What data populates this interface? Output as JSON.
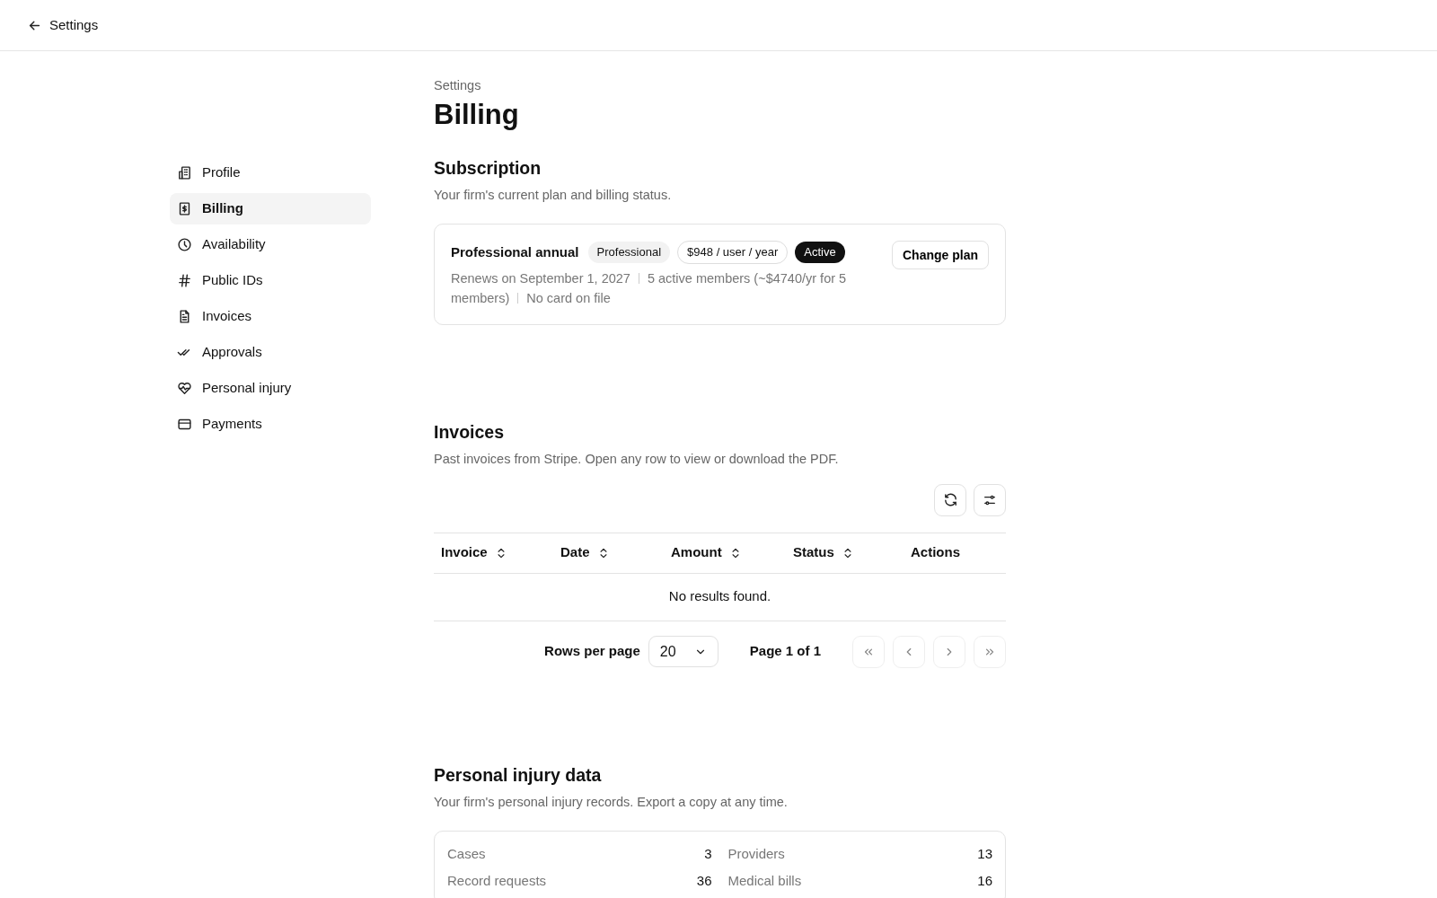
{
  "topbar": {
    "back_label": "Settings"
  },
  "sidebar": {
    "items": [
      {
        "label": "Profile",
        "selected": false
      },
      {
        "label": "Billing",
        "selected": true
      },
      {
        "label": "Availability",
        "selected": false
      },
      {
        "label": "Public IDs",
        "selected": false
      },
      {
        "label": "Invoices",
        "selected": false
      },
      {
        "label": "Approvals",
        "selected": false
      },
      {
        "label": "Personal injury",
        "selected": false
      },
      {
        "label": "Payments",
        "selected": false
      }
    ]
  },
  "header": {
    "breadcrumb": "Settings",
    "title": "Billing"
  },
  "subscription": {
    "title": "Subscription",
    "description": "Your firm's current plan and billing status.",
    "plan": {
      "name": "Professional annual",
      "tier": "Professional",
      "price": "$948 / user / year",
      "status": "Active",
      "details": [
        "Renews on September 1, 2027",
        "5 active members (~$4740/yr for 5 members)",
        "No card on file"
      ]
    },
    "action": "Change plan"
  },
  "invoices": {
    "title": "Invoices",
    "description": "Past invoices from Stripe. Open any row to view or download the PDF.",
    "columns": [
      {
        "label": "Invoice",
        "sortable": true
      },
      {
        "label": "Date",
        "sortable": true
      },
      {
        "label": "Amount",
        "sortable": true
      },
      {
        "label": "Status",
        "sortable": true
      },
      {
        "label": "Actions",
        "sortable": false
      }
    ],
    "empty_message": "No results found.",
    "pagination": {
      "rows_per_page_label": "Rows per page",
      "rows_per_page": "20",
      "page_label": "Page 1 of 1",
      "buttons": [
        {
          "disabled": true
        },
        {
          "disabled": true
        },
        {
          "disabled": true
        },
        {
          "disabled": true
        }
      ]
    }
  },
  "personal_injury": {
    "title": "Personal injury data",
    "description": "Your firm's personal injury records. Export a copy at any time.",
    "stats": [
      {
        "label": "Cases",
        "value": "3"
      },
      {
        "label": "Providers",
        "value": "13"
      },
      {
        "label": "Record requests",
        "value": "36"
      },
      {
        "label": "Medical bills",
        "value": "16"
      }
    ]
  }
}
